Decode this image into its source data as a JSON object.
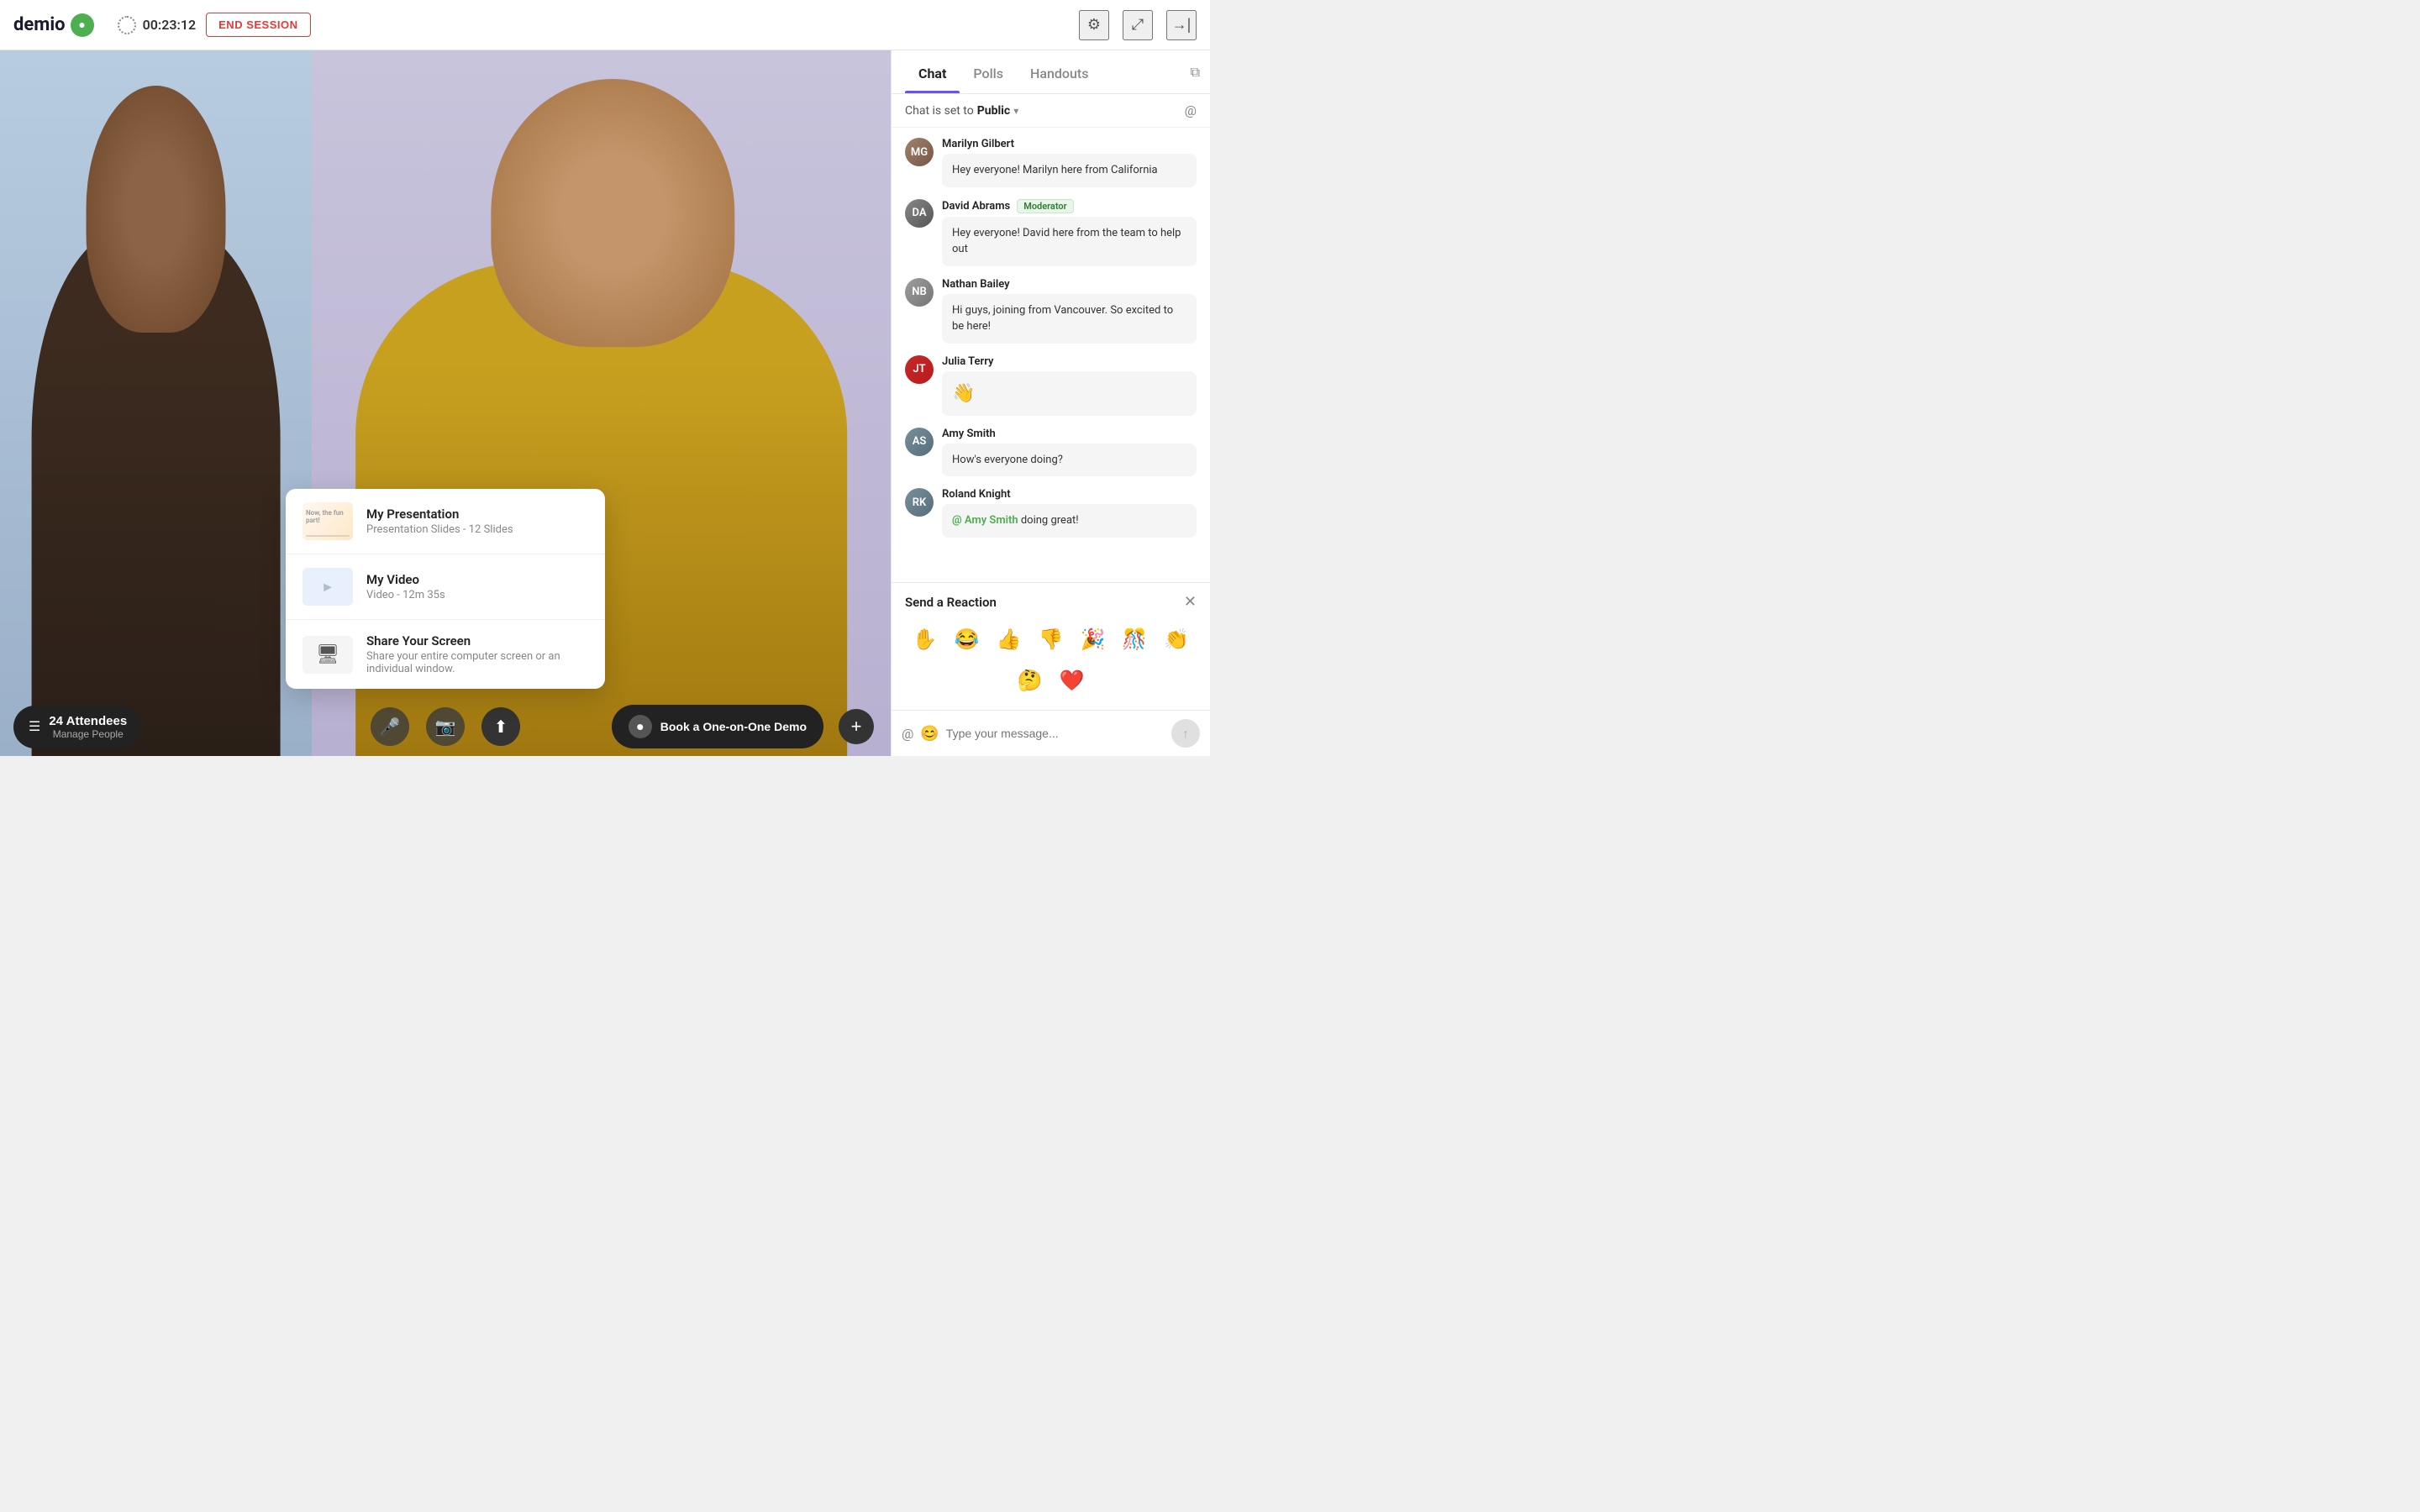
{
  "header": {
    "logo_text": "demio",
    "timer": "00:23:12",
    "end_session_label": "END SESSION",
    "icons": [
      "settings",
      "expand",
      "enter"
    ]
  },
  "tabs": {
    "items": [
      {
        "label": "Chat",
        "active": true
      },
      {
        "label": "Polls",
        "active": false
      },
      {
        "label": "Handouts",
        "active": false
      }
    ]
  },
  "chat": {
    "status_prefix": "Chat is set to ",
    "status_value": "Public",
    "messages": [
      {
        "id": 1,
        "name": "Marilyn Gilbert",
        "badge": null,
        "text": "Hey everyone! Marilyn here from California",
        "initials": "MG"
      },
      {
        "id": 2,
        "name": "David Abrams",
        "badge": "Moderator",
        "text": "Hey everyone! David here from the team to help out",
        "initials": "DA"
      },
      {
        "id": 3,
        "name": "Nathan Bailey",
        "badge": null,
        "text": "Hi guys, joining from Vancouver. So excited to be here!",
        "initials": "NB"
      },
      {
        "id": 4,
        "name": "Julia Terry",
        "badge": null,
        "emoji": "👋",
        "text": null,
        "initials": "JT"
      },
      {
        "id": 5,
        "name": "Amy Smith",
        "badge": null,
        "text": "How's everyone doing?",
        "initials": "AS"
      },
      {
        "id": 6,
        "name": "Roland Knight",
        "badge": null,
        "mention": "Amy Smith",
        "mention_suffix": " doing great!",
        "text": null,
        "initials": "RK"
      }
    ],
    "input_placeholder": "Type your message..."
  },
  "reaction": {
    "title": "Send a Reaction",
    "emojis": [
      "✋",
      "😂",
      "👍",
      "👎",
      "🎉",
      "🎊",
      "👏",
      "🤔",
      "❤️"
    ]
  },
  "media_selector": {
    "items": [
      {
        "title": "My Presentation",
        "subtitle": "Presentation Slides - 12 Slides",
        "type": "presentation"
      },
      {
        "title": "My Video",
        "subtitle": "Video - 12m 35s",
        "type": "video"
      },
      {
        "title": "Share Your Screen",
        "subtitle": "Share your entire computer screen or an individual window.",
        "type": "screen"
      }
    ]
  },
  "toolbar": {
    "attendees_count": "24 Attendees",
    "manage_label": "Manage People",
    "book_demo_label": "Book a One-on-One Demo",
    "plus_label": "+"
  },
  "colors": {
    "accent": "#6c4ff6",
    "moderator_bg": "#e8f5e9",
    "moderator_text": "#2e7d32",
    "mention": "#4CAF50",
    "end_session": "#e53935"
  }
}
